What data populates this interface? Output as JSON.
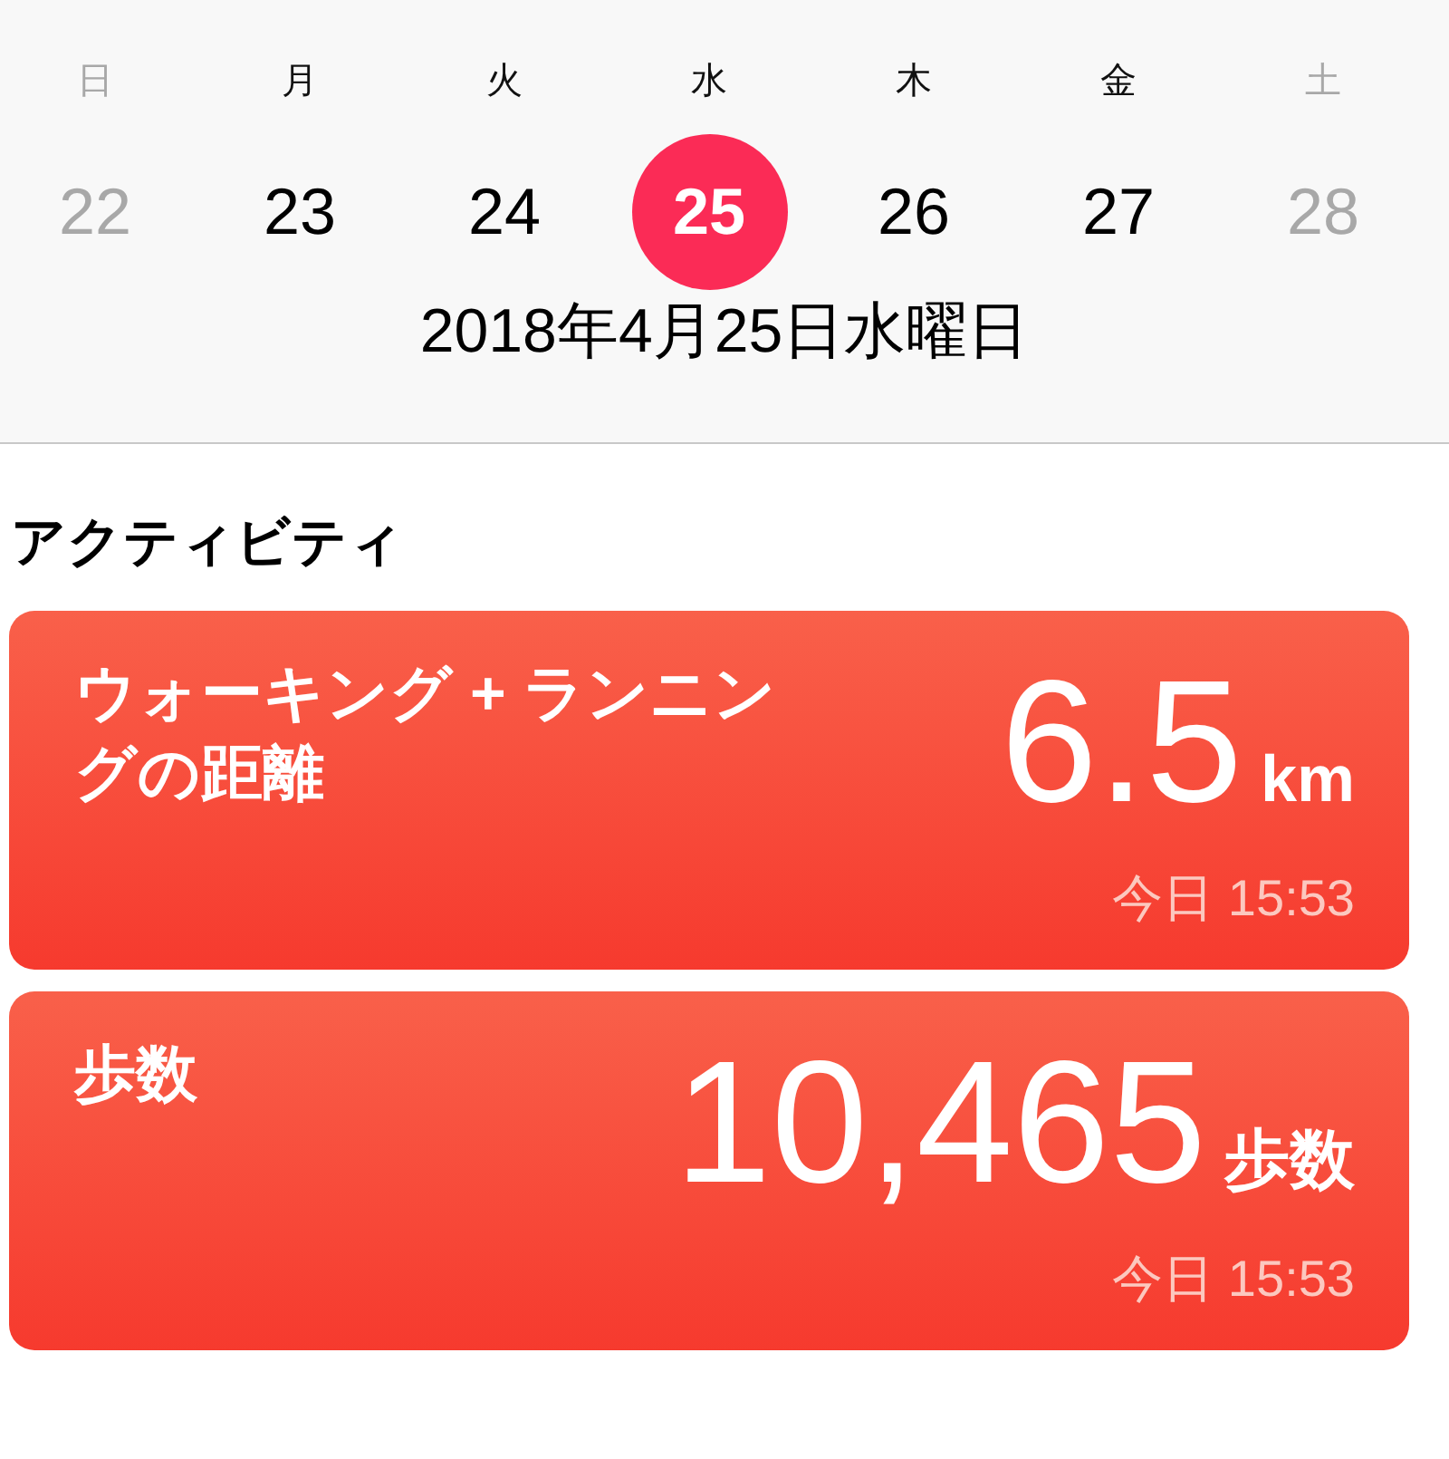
{
  "week": [
    {
      "weekday": "日",
      "date": "22",
      "dimmed": true,
      "selected": false
    },
    {
      "weekday": "月",
      "date": "23",
      "dimmed": false,
      "selected": false
    },
    {
      "weekday": "火",
      "date": "24",
      "dimmed": false,
      "selected": false
    },
    {
      "weekday": "水",
      "date": "25",
      "dimmed": false,
      "selected": true
    },
    {
      "weekday": "木",
      "date": "26",
      "dimmed": false,
      "selected": false
    },
    {
      "weekday": "金",
      "date": "27",
      "dimmed": false,
      "selected": false
    },
    {
      "weekday": "土",
      "date": "28",
      "dimmed": true,
      "selected": false
    }
  ],
  "date_label": "2018年4月25日水曜日",
  "section_title": "アクティビティ",
  "cards": [
    {
      "title": "ウォーキング + ランニングの距離",
      "value": "6.5",
      "unit": "km",
      "time": "今日 15:53"
    },
    {
      "title": "歩数",
      "value": "10,465",
      "unit": "歩数",
      "time": "今日 15:53"
    }
  ]
}
